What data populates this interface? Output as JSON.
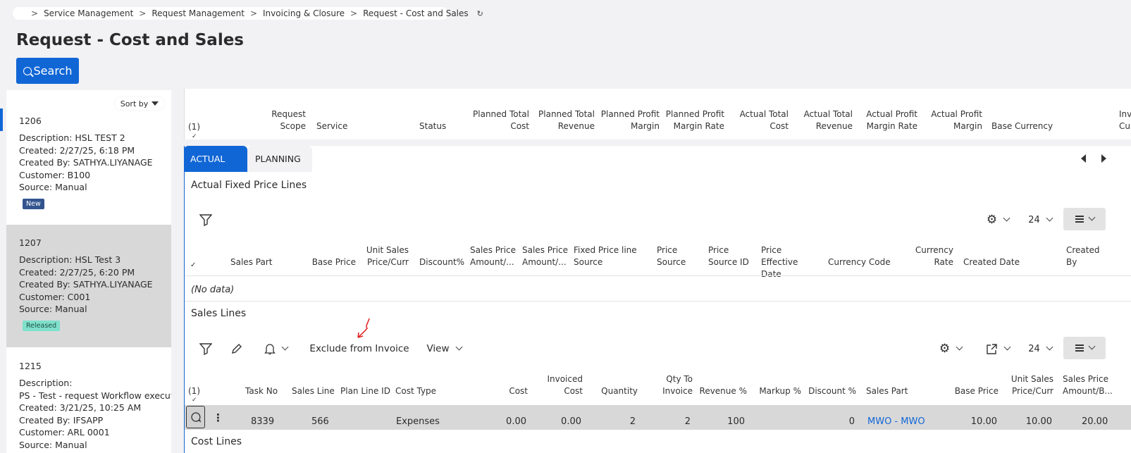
{
  "breadcrumb": {
    "items": [
      "Service Management",
      "Request Management",
      "Invoicing & Closure",
      "Request - Cost and Sales"
    ],
    "refresh_icon": "refresh-icon"
  },
  "page": {
    "title": "Request - Cost and Sales"
  },
  "search": {
    "label": "Search"
  },
  "list": {
    "sort_label": "Sort by",
    "cards": [
      {
        "num": "1206",
        "description": "Description:   HSL TEST 2",
        "created": "Created:   2/27/25, 6:18 PM",
        "created_by": "Created By:   SATHYA.LIYANAGE",
        "customer": "Customer:   B100",
        "source": "Source:   Manual",
        "badge": "New"
      },
      {
        "num": "1207",
        "description": "Description:   HSL Test 3",
        "created": "Created:   2/27/25, 6:20 PM",
        "created_by": "Created By:   SATHYA.LIYANAGE",
        "customer": "Customer:   C001",
        "source": "Source:   Manual",
        "badge": "Released"
      },
      {
        "num": "1215",
        "description_label": "Description:",
        "description": "PS - Test - request Workflow executio",
        "created": "Created:   3/21/25, 10:25 AM",
        "created_by": "Created By:   IFSAPP",
        "customer": "Customer:   ARL 0001",
        "source": "Source:   Manual"
      }
    ]
  },
  "top_table": {
    "count": "(1)",
    "headers": [
      "Request Scope",
      "Service",
      "Status",
      "Planned Total Cost",
      "Planned Total Revenue",
      "Planned Profit Margin",
      "Planned Profit Margin Rate",
      "Actual Total Cost",
      "Actual Total Revenue",
      "Actual Profit Margin Rate",
      "Actual Profit Margin",
      "Base Currency",
      "Inv Cu"
    ]
  },
  "tabs": {
    "actual": "ACTUAL",
    "planning": "PLANNING"
  },
  "fixed_price": {
    "title": "Actual Fixed Price Lines",
    "page_size": "24",
    "headers": [
      "Sales Part",
      "Base Price",
      "Unit Sales Price/Curr",
      "Discount%",
      "Sales Price Amount/...",
      "Sales Price Amount/...",
      "Fixed Price line Source",
      "Price Source",
      "Price Source ID",
      "Price Effective Date",
      "Currency Code",
      "Currency Rate",
      "Created Date",
      "Created By"
    ],
    "empty": "(No data)"
  },
  "sales_lines": {
    "title": "Sales Lines",
    "exclude_label": "Exclude from Invoice",
    "view_label": "View",
    "page_size": "24",
    "count": "(1)",
    "headers": [
      "Task No",
      "Sales Line",
      "Plan Line ID",
      "Cost Type",
      "Cost",
      "Invoiced Cost",
      "Quantity",
      "Qty To Invoice",
      "Revenue %",
      "Markup %",
      "Discount %",
      "Sales Part",
      "Base Price",
      "Unit Sales Price/Curr",
      "Sales Price Amount/B..."
    ],
    "row": {
      "task_no": "8339",
      "sales_line": "566",
      "plan_line_id": "",
      "cost_type": "Expenses",
      "cost": "0.00",
      "invoiced_cost": "0.00",
      "quantity": "2",
      "qty_to_invoice": "2",
      "revenue": "100",
      "markup": "",
      "discount": "0",
      "sales_part": "MWO - MWO",
      "base_price": "10.00",
      "unit_sales_price": "10.00",
      "sales_price_amount": "20.00"
    }
  },
  "cost_lines": {
    "title": "Cost Lines"
  },
  "colors": {
    "accent": "#1166d6",
    "annotation": "#e02020"
  }
}
